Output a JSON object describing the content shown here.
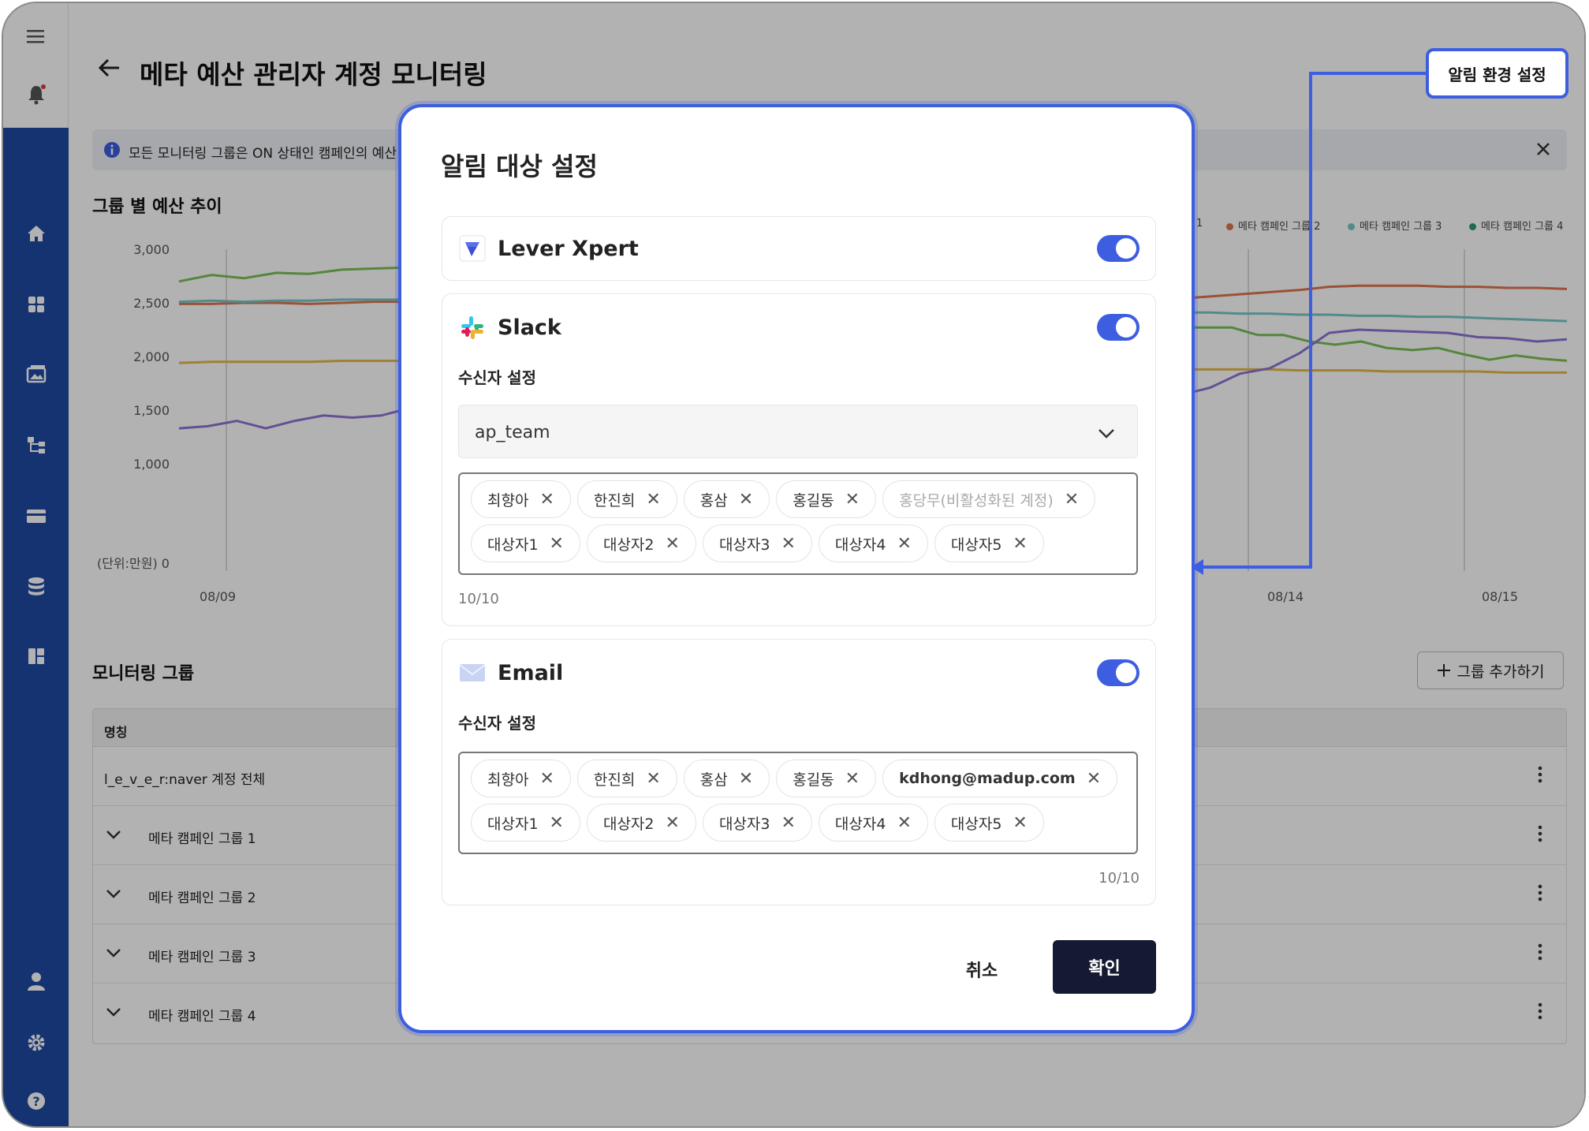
{
  "page": {
    "title": "메타 예산 관리자 계정 모니터링",
    "banner_text": "모든 모니터링 그룹은 ON 상태인 캠페인의 예산 금",
    "chart_section_title": "그룹 별 예산 추이",
    "group_section_title": "모니터링 그룹",
    "add_group_label": "그룹 추가하기",
    "table_header": "명칭",
    "rows": [
      {
        "label": "l_e_v_e_r:naver 계정 전체",
        "expandable": false
      },
      {
        "label": "메타 캠페인 그룹 1",
        "expandable": true
      },
      {
        "label": "메타 캠페인 그룹 2",
        "expandable": true
      },
      {
        "label": "메타 캠페인 그룹 3",
        "expandable": true
      },
      {
        "label": "메타 캠페인 그룹 4",
        "expandable": true
      }
    ]
  },
  "callout": {
    "label": "알림 환경 설정"
  },
  "chart_data": {
    "type": "line",
    "y_ticks": [
      "3,000",
      "2,500",
      "2,000",
      "1,500",
      "1,000",
      "(단위:만원) 0"
    ],
    "x_ticks": [
      "08/09",
      "08/14",
      "08/15"
    ],
    "legend_visible": [
      "1",
      "메타 캠페인 그룹 2",
      "메타 캠페인 그룹 3",
      "메타 캠페인 그룹 4"
    ],
    "ylim": [
      0,
      3000
    ],
    "series": [
      {
        "color": "#e0744e",
        "left_values": [
          2490,
          2490,
          2500,
          2500,
          2490,
          2500,
          2510,
          2510,
          2520
        ],
        "right_values": [
          2540,
          2560,
          2580,
          2600,
          2620,
          2650,
          2660,
          2660,
          2660,
          2650,
          2650,
          2640,
          2640,
          2630
        ]
      },
      {
        "color": "#77c7c8",
        "left_values": [
          2510,
          2520,
          2510,
          2520,
          2520,
          2530,
          2530,
          2530,
          2530
        ],
        "right_values": [
          2410,
          2410,
          2400,
          2400,
          2390,
          2390,
          2380,
          2380,
          2370,
          2370,
          2360,
          2350,
          2340,
          2330
        ]
      },
      {
        "color": "#7ac058",
        "left_values": [
          2700,
          2760,
          2730,
          2780,
          2770,
          2810,
          2820,
          2830,
          2840
        ],
        "right_values": [
          2270,
          2270,
          2270,
          2200,
          2200,
          2140,
          2110,
          2140,
          2080,
          2060,
          2080,
          2020,
          1970,
          2010,
          1980,
          1960
        ]
      },
      {
        "color": "#e6b84a",
        "left_values": [
          1940,
          1950,
          1950,
          1950,
          1950,
          1960,
          1960,
          1960,
          1960
        ],
        "right_values": [
          1880,
          1880,
          1880,
          1880,
          1870,
          1870,
          1870,
          1860,
          1860,
          1860,
          1860,
          1850,
          1850,
          1850
        ]
      },
      {
        "color": "#8f73d6",
        "left_values": [
          1330,
          1350,
          1400,
          1330,
          1400,
          1450,
          1430,
          1450,
          1520,
          1490
        ],
        "right_values": [
          1640,
          1710,
          1840,
          1890,
          2030,
          2220,
          2250,
          2240,
          2230,
          2220,
          2180,
          2170,
          2140,
          2160
        ]
      }
    ]
  },
  "modal": {
    "title": "알림 대상 설정",
    "lever": {
      "name": "Lever Xpert",
      "enabled": true
    },
    "slack": {
      "name": "Slack",
      "enabled": true,
      "recipient_label": "수신자 설정",
      "channel": "ap_team",
      "chips": [
        {
          "label": "최향아",
          "disabled": false
        },
        {
          "label": "한진희",
          "disabled": false
        },
        {
          "label": "홍삼",
          "disabled": false
        },
        {
          "label": "홍길동",
          "disabled": false
        },
        {
          "label": "홍당무(비활성화된 계정)",
          "disabled": true
        },
        {
          "label": "대상자1",
          "disabled": false
        },
        {
          "label": "대상자2",
          "disabled": false
        },
        {
          "label": "대상자3",
          "disabled": false
        },
        {
          "label": "대상자4",
          "disabled": false
        },
        {
          "label": "대상자5",
          "disabled": false
        }
      ],
      "count": "10/10"
    },
    "email": {
      "name": "Email",
      "enabled": true,
      "recipient_label": "수신자 설정",
      "chips": [
        {
          "label": "최향아",
          "bold": false
        },
        {
          "label": "한진희",
          "bold": false
        },
        {
          "label": "홍삼",
          "bold": false
        },
        {
          "label": "홍길동",
          "bold": false
        },
        {
          "label": "kdhong@madup.com",
          "bold": true
        },
        {
          "label": "대상자1",
          "bold": false
        },
        {
          "label": "대상자2",
          "bold": false
        },
        {
          "label": "대상자3",
          "bold": false
        },
        {
          "label": "대상자4",
          "bold": false
        },
        {
          "label": "대상자5",
          "bold": false
        }
      ],
      "count": "10/10"
    },
    "cancel_label": "취소",
    "confirm_label": "확인"
  },
  "colors": {
    "accent": "#3d5ee0",
    "sidebar": "#1f4aa3",
    "confirm_bg": "#151a33"
  }
}
